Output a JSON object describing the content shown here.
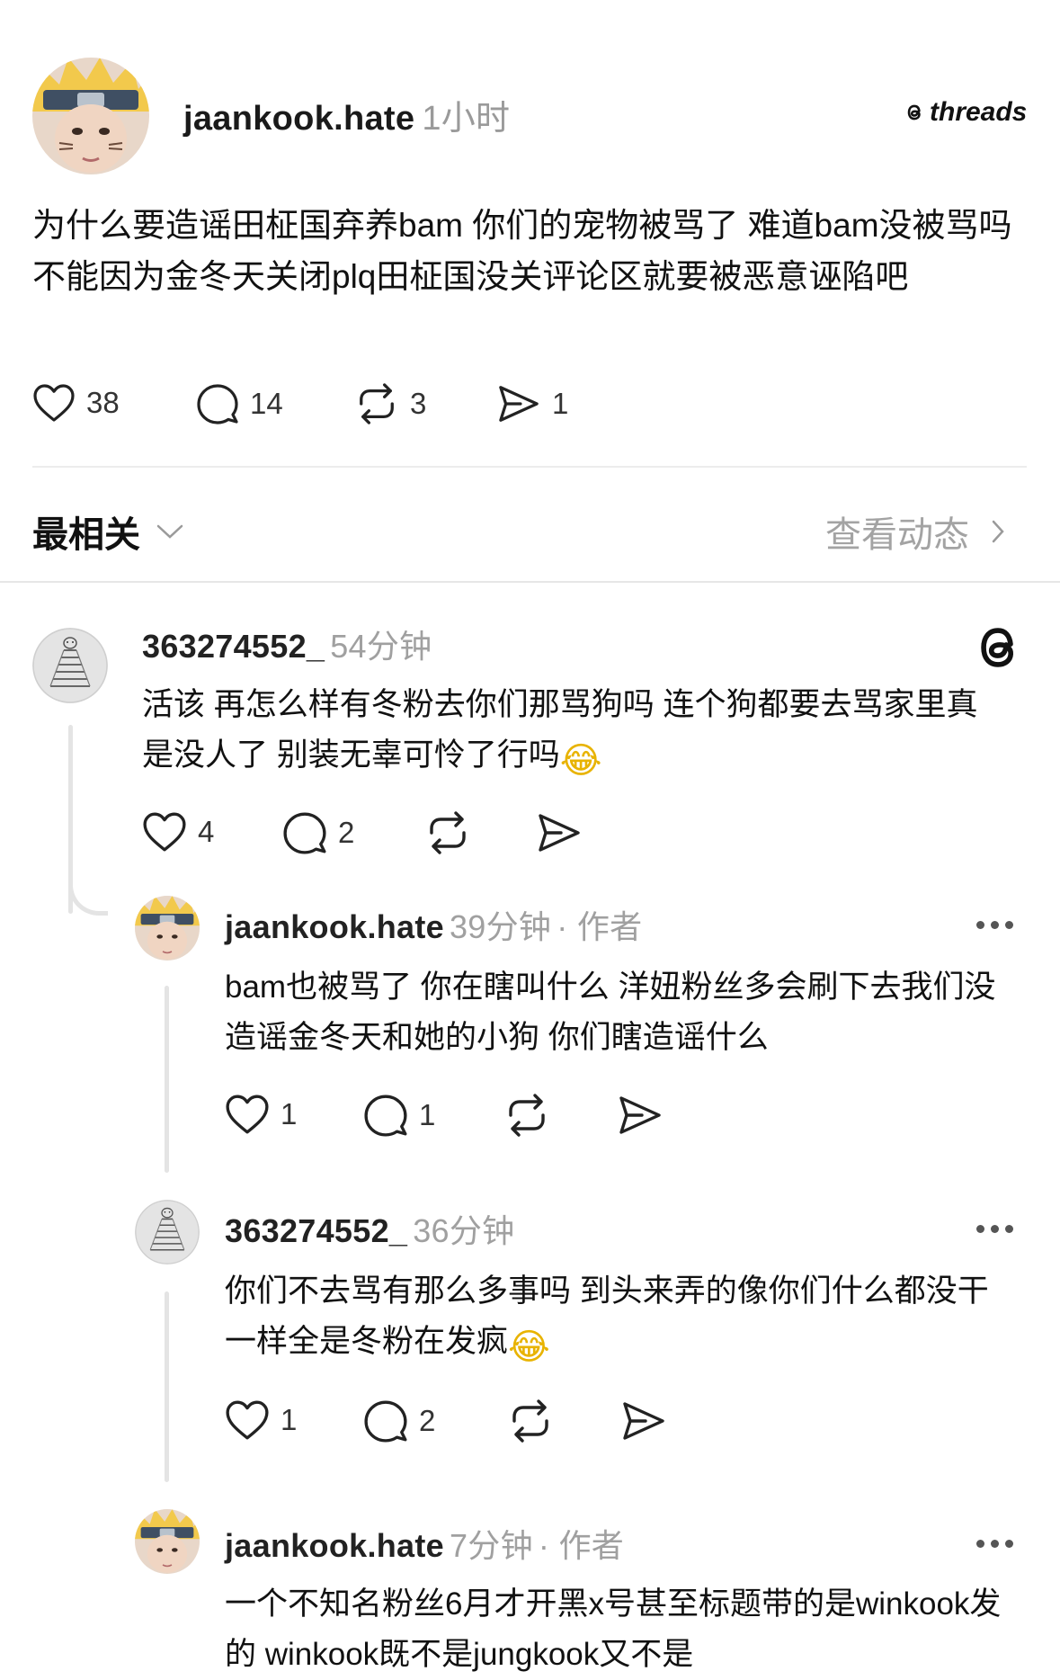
{
  "post": {
    "username": "jaankook.hate",
    "time": "1小时",
    "brand": "threads",
    "text": "为什么要造谣田柾国弃养bam  你们的宠物被骂了  难道bam没被骂吗  不能因为金冬天关闭plq田柾国没关评论区就要被恶意诬陷吧",
    "likes": "38",
    "replies": "14",
    "reposts": "3",
    "shares": "1"
  },
  "sort": {
    "label": "最相关",
    "activity_link": "查看动态"
  },
  "comments": [
    {
      "username": "363274552_",
      "time": "54分钟",
      "text": "活该  再怎么样有冬粉去你们那骂狗吗  连个狗都要去骂家里真是没人了  别装无辜可怜了行吗",
      "emoji": "😂",
      "likes": "4",
      "replies": "2"
    },
    {
      "username": "jaankook.hate",
      "time": "39分钟",
      "author_tag": "· 作者",
      "text": "bam也被骂了  你在瞎叫什么  洋妞粉丝多会刷下去我们没造谣金冬天和她的小狗  你们瞎造谣什么",
      "likes": "1",
      "replies": "1"
    },
    {
      "username": "363274552_",
      "time": "36分钟",
      "text": "你们不去骂有那么多事吗  到头来弄的像你们什么都没干一样全是冬粉在发疯",
      "emoji": "😂",
      "likes": "1",
      "replies": "2"
    },
    {
      "username": "jaankook.hate",
      "time": "7分钟",
      "author_tag": "· 作者",
      "text": "一个不知名粉丝6月才开黑x号甚至标题带的是winkook发的  winkook既不是jungkook又不是"
    }
  ],
  "colors": {
    "text": "#111111",
    "muted": "#a0a0a0",
    "divider": "#ececec",
    "thread_line": "#e4e4e4"
  }
}
